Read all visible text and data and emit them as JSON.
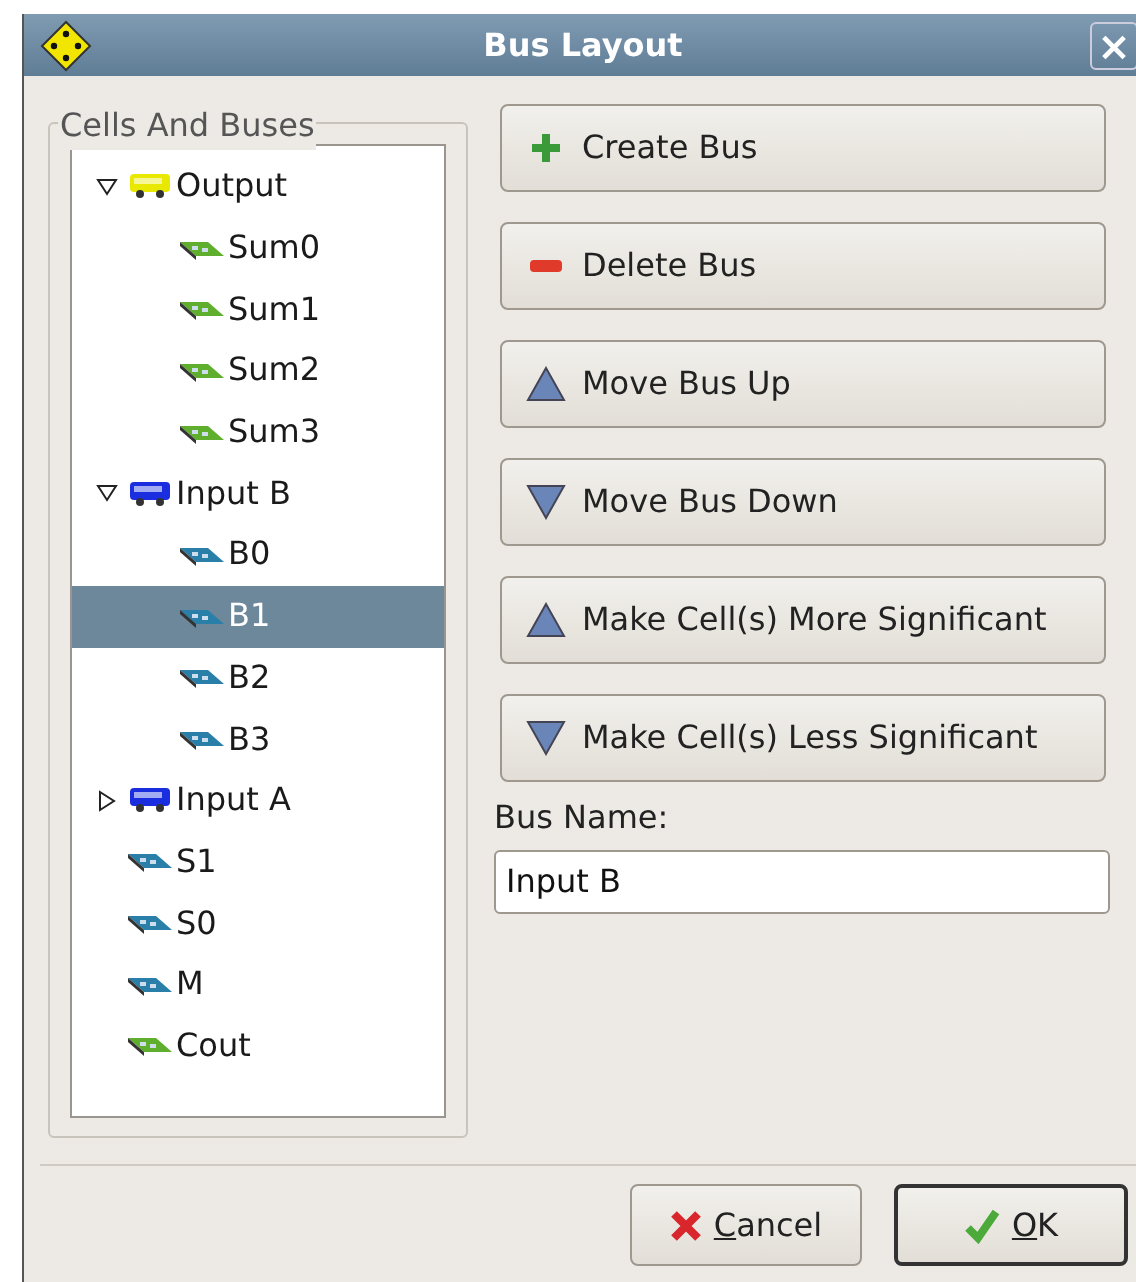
{
  "window": {
    "title": "Bus Layout",
    "close": "×"
  },
  "tree": {
    "title": "Cells And Buses",
    "items": [
      {
        "label": "Output",
        "kind": "bus",
        "color": "#e8e800",
        "expanded": true,
        "selected": false,
        "children": [
          {
            "label": "Sum0",
            "kind": "cell",
            "color": "#5fae2e",
            "selected": false
          },
          {
            "label": "Sum1",
            "kind": "cell",
            "color": "#5fae2e",
            "selected": false
          },
          {
            "label": "Sum2",
            "kind": "cell",
            "color": "#5fae2e",
            "selected": false
          },
          {
            "label": "Sum3",
            "kind": "cell",
            "color": "#5fae2e",
            "selected": false
          }
        ]
      },
      {
        "label": "Input B",
        "kind": "bus",
        "color": "#1a2ee0",
        "expanded": true,
        "selected": false,
        "children": [
          {
            "label": "B0",
            "kind": "cell",
            "color": "#2a7fa8",
            "selected": false
          },
          {
            "label": "B1",
            "kind": "cell",
            "color": "#2a7fa8",
            "selected": true
          },
          {
            "label": "B2",
            "kind": "cell",
            "color": "#2a7fa8",
            "selected": false
          },
          {
            "label": "B3",
            "kind": "cell",
            "color": "#2a7fa8",
            "selected": false
          }
        ]
      },
      {
        "label": "Input A",
        "kind": "bus",
        "color": "#1a2ee0",
        "expanded": false,
        "selected": false
      },
      {
        "label": "S1",
        "kind": "cell",
        "color": "#2a7fa8",
        "selected": false
      },
      {
        "label": "S0",
        "kind": "cell",
        "color": "#2a7fa8",
        "selected": false
      },
      {
        "label": "M",
        "kind": "cell",
        "color": "#2a7fa8",
        "selected": false
      },
      {
        "label": "Cout",
        "kind": "cell",
        "color": "#5fae2e",
        "selected": false
      }
    ]
  },
  "actions": [
    {
      "label": "Create Bus",
      "kind": "plus"
    },
    {
      "label": "Delete Bus",
      "kind": "minus"
    },
    {
      "label": "Move Bus Up",
      "kind": "up"
    },
    {
      "label": "Move Bus Down",
      "kind": "down"
    },
    {
      "label": "Make Cell(s) More Significant",
      "kind": "up"
    },
    {
      "label": "Make Cell(s) Less Significant",
      "kind": "down"
    }
  ],
  "bus_name": {
    "label": "Bus Name:",
    "value": "Input B"
  },
  "buttons": [
    {
      "label": "Cancel",
      "kind": "cancel",
      "underline_first": true,
      "default": false
    },
    {
      "label": "OK",
      "kind": "ok",
      "underline_first": true,
      "default": true
    }
  ]
}
